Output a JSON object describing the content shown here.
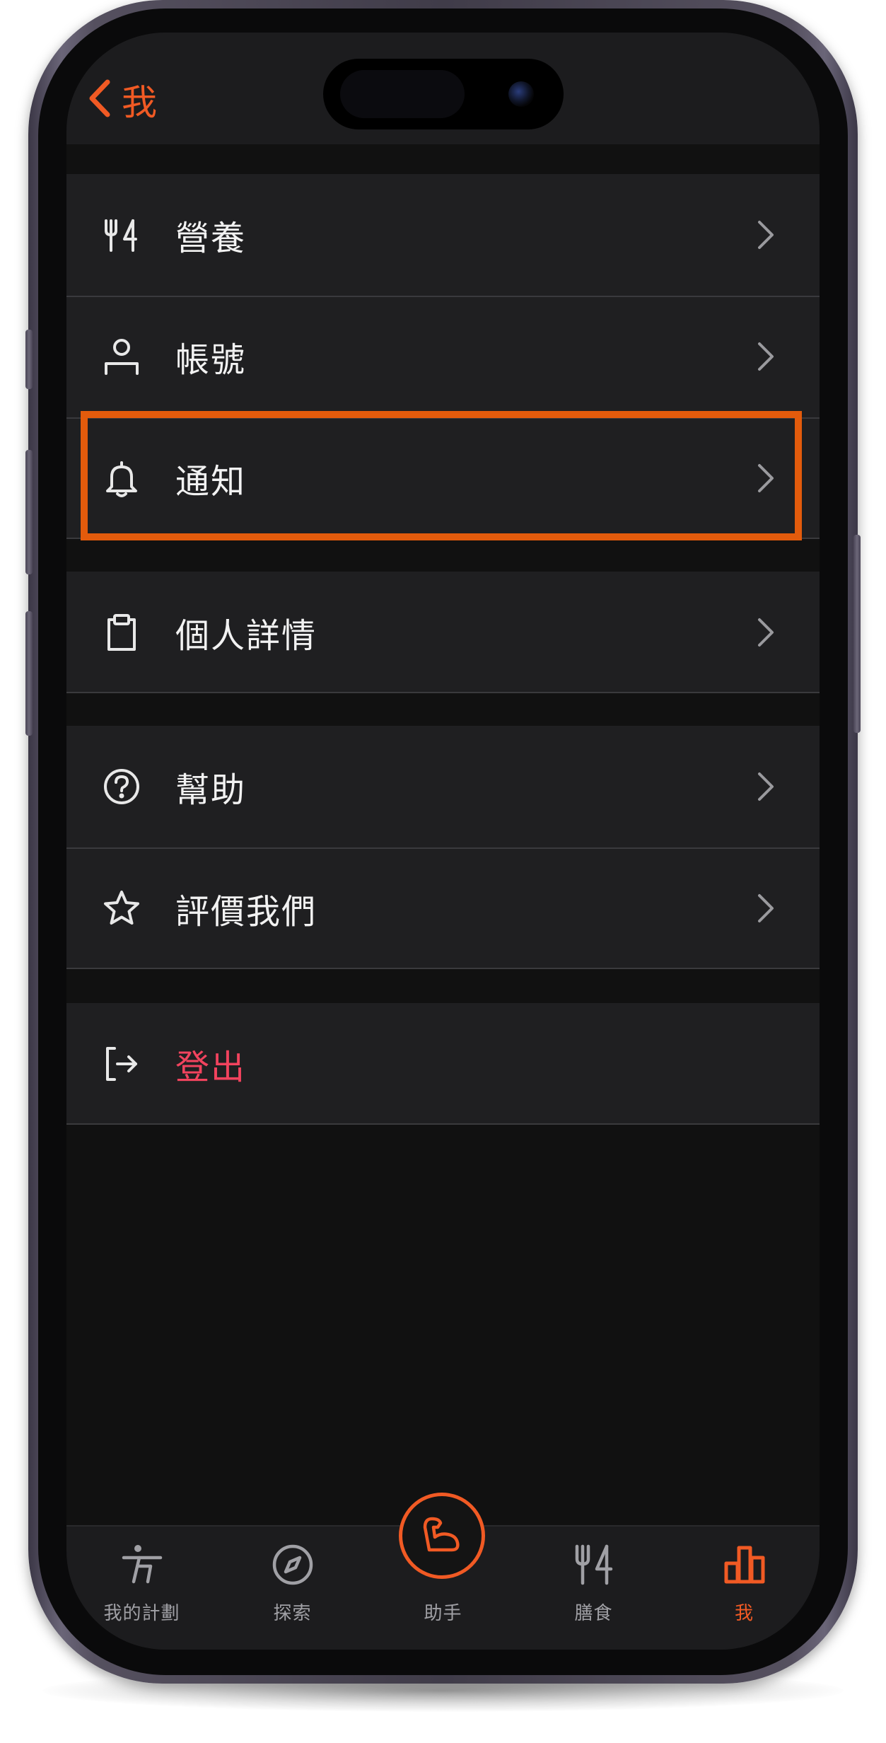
{
  "header": {
    "back_label": "我"
  },
  "menu_groups": [
    {
      "items": [
        {
          "label": "營養",
          "icon": "fork-knife-icon"
        },
        {
          "label": "帳號",
          "icon": "person-icon"
        },
        {
          "label": "通知",
          "icon": "bell-icon"
        }
      ]
    },
    {
      "items": [
        {
          "label": "個人詳情",
          "icon": "clipboard-icon"
        }
      ]
    },
    {
      "items": [
        {
          "label": "幫助",
          "icon": "question-circle-icon"
        },
        {
          "label": "評價我們",
          "icon": "star-icon"
        }
      ]
    },
    {
      "items": [
        {
          "label": "登出",
          "icon": "logout-icon"
        }
      ]
    }
  ],
  "tab_bar": {
    "tabs": [
      {
        "label": "我的計劃",
        "icon": "plan-figure-icon"
      },
      {
        "label": "探索",
        "icon": "compass-icon"
      },
      {
        "label": "助手",
        "icon": "muscle-arm-icon"
      },
      {
        "label": "膳食",
        "icon": "fork-knife-icon"
      },
      {
        "label": "我",
        "icon": "bar-chart-icon"
      }
    ],
    "active_index": 4
  },
  "colors": {
    "accent": "#f15a24",
    "highlight_border": "#e35b0c",
    "danger": "#f2435e",
    "screen_background": "#111111",
    "row_background": "#1f1f21",
    "inactive_tab": "#a0a0a5"
  }
}
